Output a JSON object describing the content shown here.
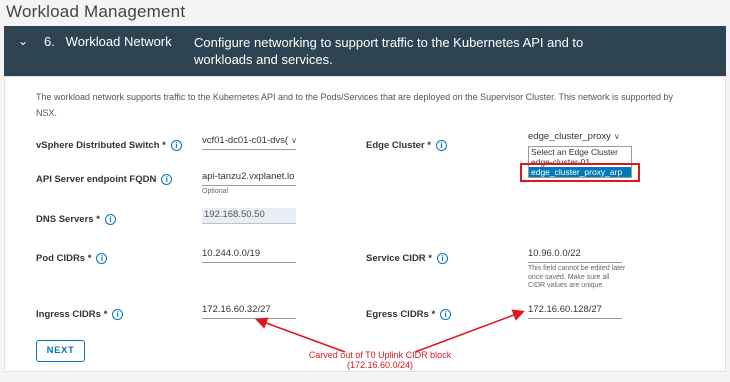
{
  "page": {
    "title": "Workload Management"
  },
  "step": {
    "chevron": "⌄",
    "number_title": "6.   Workload Network",
    "description": "Configure networking to support traffic to the Kubernetes API and to workloads and services."
  },
  "intro": "The workload network supports traffic to the Kubernetes API and to the Pods/Services that are deployed on the Supervisor Cluster. This network is supported by NSX.",
  "fields": {
    "vds": {
      "label": "vSphere Distributed Switch *",
      "value": "vcf01-dc01-c01-dvs(",
      "icon": "info-icon"
    },
    "edge_cluster": {
      "label": "Edge Cluster *",
      "value": "edge_cluster_proxy"
    },
    "api_fqdn": {
      "label": "API Server endpoint FQDN",
      "value": "api-tanzu2.vxplanet.lo",
      "helper": "Optional"
    },
    "dns": {
      "label": "DNS Servers *",
      "value": "192.168.50.50"
    },
    "pod_cidrs": {
      "label": "Pod CIDRs *",
      "value": "10.244.0.0/19"
    },
    "service_cidr": {
      "label": "Service CIDR *",
      "value": "10.96.0.0/22",
      "helper": "This field cannot be edited later once saved. Make sure all CIDR values are unique."
    },
    "ingress_cidrs": {
      "label": "Ingress CIDRs *",
      "value": "172.16.60.32/27"
    },
    "egress_cidrs": {
      "label": "Egress CIDRs *",
      "value": "172.16.60.128/27"
    }
  },
  "edge_dropdown": {
    "options": [
      "Select an Edge Cluster",
      "edge-cluster-01",
      "edge_cluster_proxy_arp"
    ],
    "selected": "edge_cluster_proxy_arp"
  },
  "buttons": {
    "next": "NEXT"
  },
  "annotation": {
    "line1": "Carved out of T0 Uplink CIDR block",
    "line2": "(172.16.60.0/24)",
    "color": "#e0161d"
  },
  "colors": {
    "header_bg": "#2e4452",
    "accent": "#0079b8",
    "highlight": "#e0161d"
  }
}
